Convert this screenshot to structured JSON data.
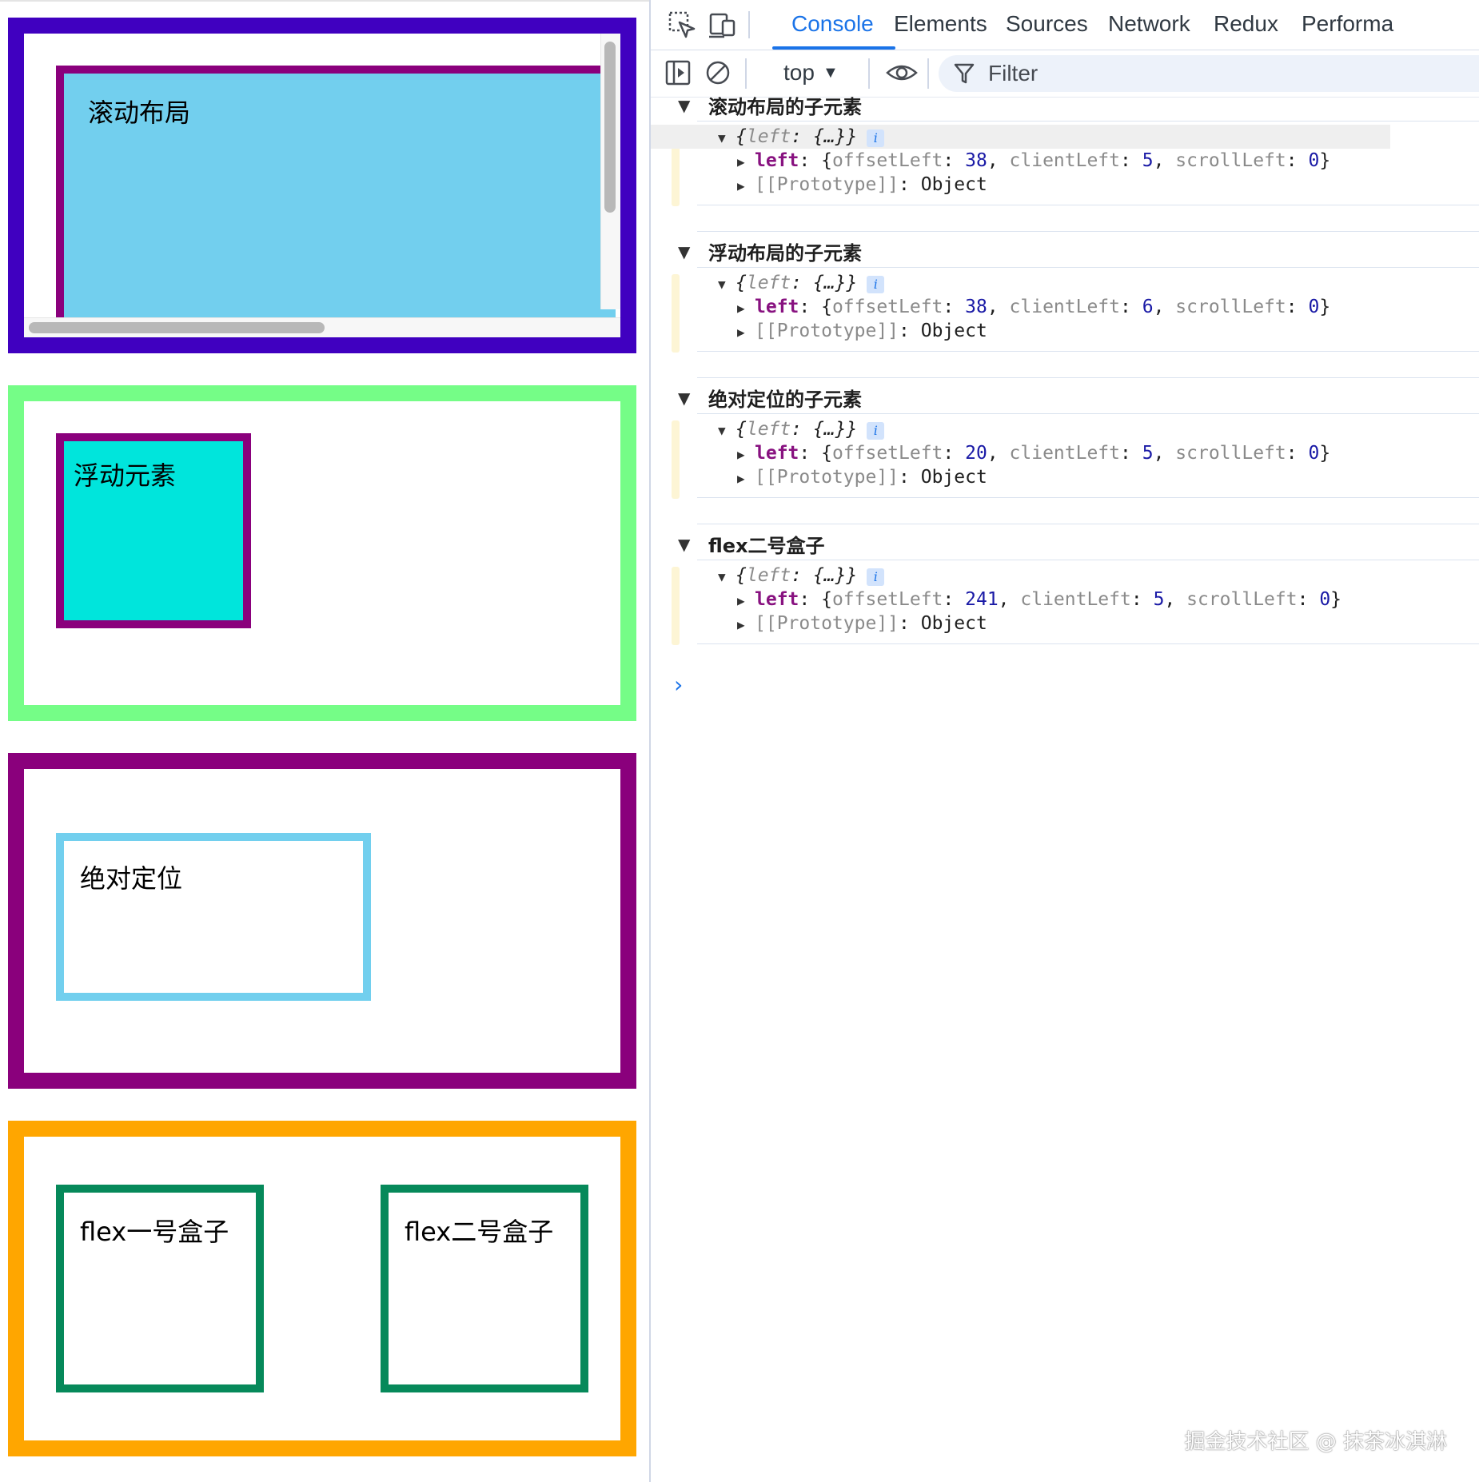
{
  "page": {
    "scroll_demo": {
      "label": "滚动布局"
    },
    "float_demo": {
      "label": "浮动元素"
    },
    "abs_demo": {
      "label": "绝对定位"
    },
    "flex_demo": {
      "box1_label": "flex一号盒子",
      "box2_label": "flex二号盒子"
    }
  },
  "devtools": {
    "tabs": [
      {
        "label": "Console",
        "active": true
      },
      {
        "label": "Elements"
      },
      {
        "label": "Sources"
      },
      {
        "label": "Network"
      },
      {
        "label": "Redux"
      },
      {
        "label": "Performa"
      }
    ],
    "toolbar": {
      "context": "top",
      "filter_placeholder": "Filter"
    },
    "groups": [
      {
        "title": "滚动布局的子元素",
        "preview_key": "left",
        "preview_val": "{…}",
        "offsetLeft": "38",
        "clientLeft": "5",
        "scrollLeft": "0",
        "proto": "[[Prototype]]",
        "proto_val": "Object"
      },
      {
        "title": "浮动布局的子元素",
        "preview_key": "left",
        "preview_val": "{…}",
        "offsetLeft": "38",
        "clientLeft": "6",
        "scrollLeft": "0",
        "proto": "[[Prototype]]",
        "proto_val": "Object"
      },
      {
        "title": "绝对定位的子元素",
        "preview_key": "left",
        "preview_val": "{…}",
        "offsetLeft": "20",
        "clientLeft": "5",
        "scrollLeft": "0",
        "proto": "[[Prototype]]",
        "proto_val": "Object"
      },
      {
        "title": "flex二号盒子",
        "preview_key": "left",
        "preview_val": "{…}",
        "offsetLeft": "241",
        "clientLeft": "5",
        "scrollLeft": "0",
        "proto": "[[Prototype]]",
        "proto_val": "Object"
      }
    ],
    "prop_names": {
      "left": "left",
      "offsetLeft": "offsetLeft",
      "clientLeft": "clientLeft",
      "scrollLeft": "scrollLeft"
    },
    "prompt": "›"
  },
  "watermark": "掘金技术社区 @ 抹茶冰淇淋",
  "colors": {
    "scroll_border": "#4000c0",
    "float_border": "#75fd87",
    "abs_border": "#8a007c",
    "flex_border": "#ffa600",
    "accent": "#1a73e8"
  }
}
